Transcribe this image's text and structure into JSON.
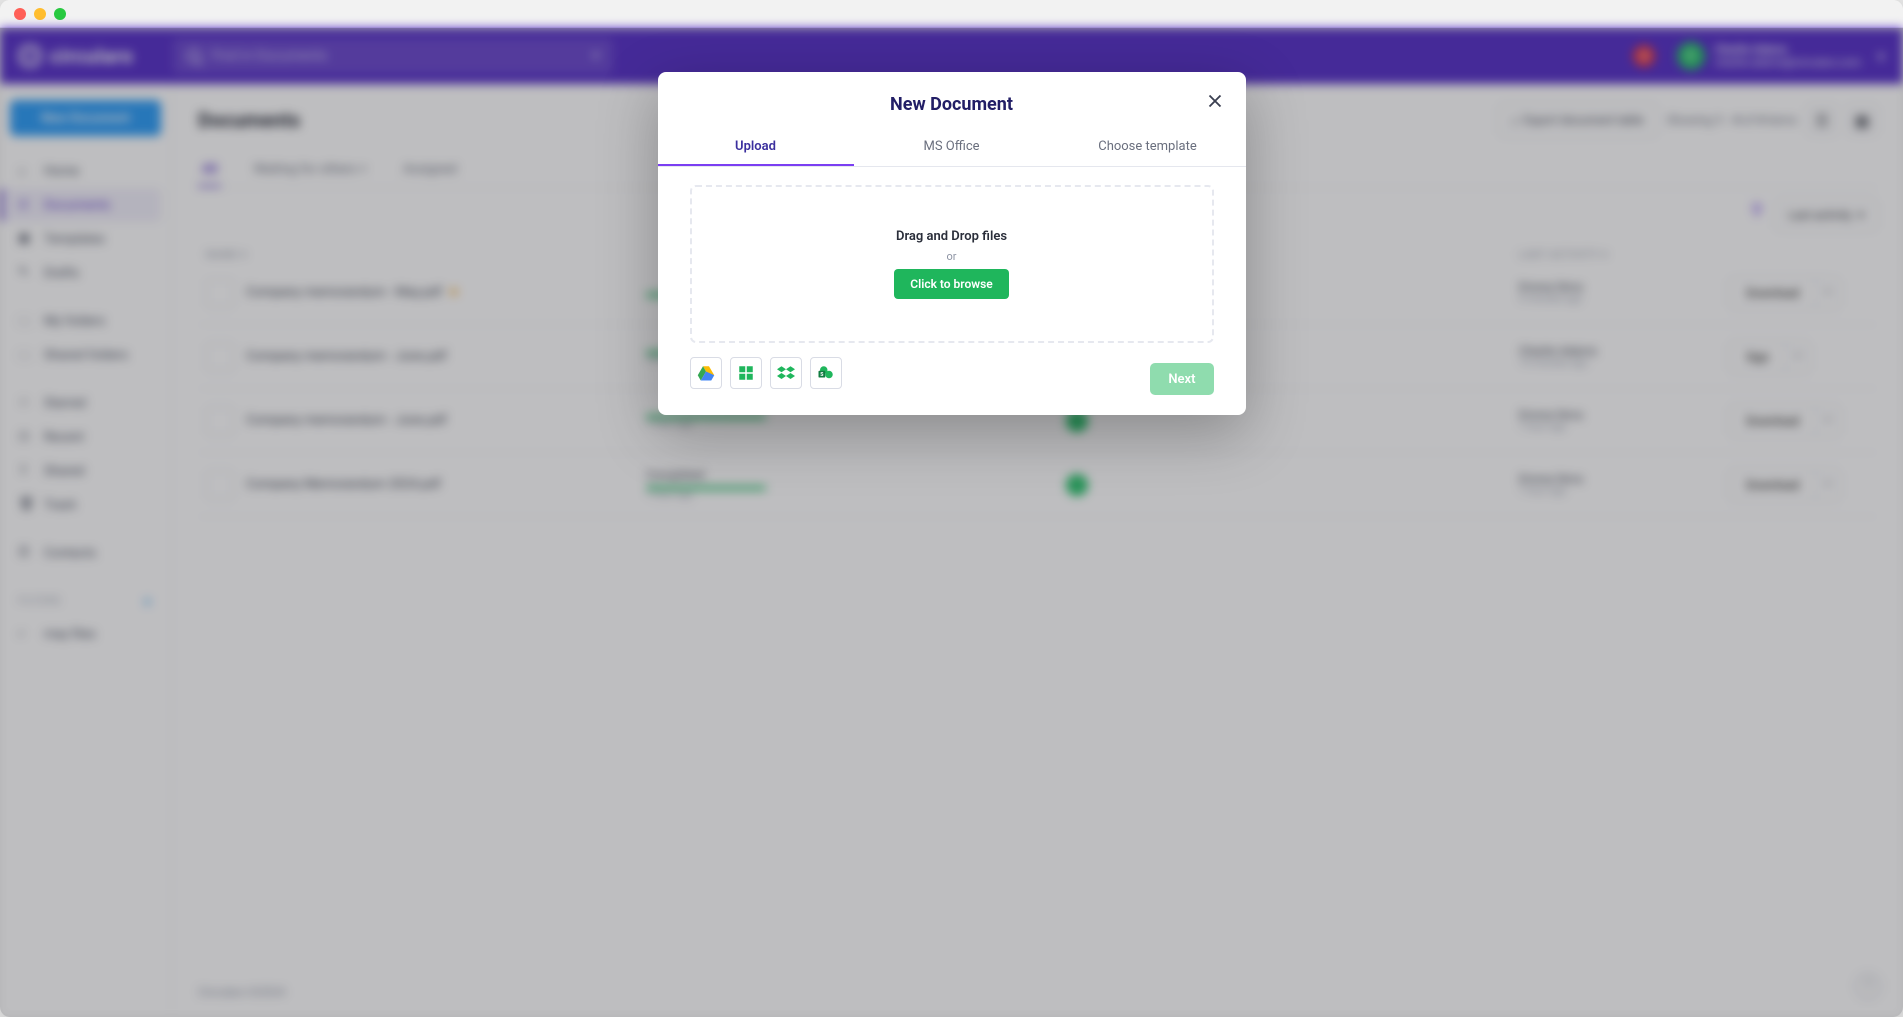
{
  "brand": "circularo",
  "search_placeholder": "Find in Documents",
  "notifications_count": "4",
  "user": {
    "initial": "C",
    "name": "Charlie Adams",
    "email": "charlie.adams@circularo.com"
  },
  "sidebar": {
    "new_doc": "New Document",
    "items": [
      "Home",
      "Documents",
      "Templates",
      "Drafts"
    ],
    "items2": [
      "My folders",
      "Shared folders"
    ],
    "items3": [
      "Starred",
      "Recent",
      "Shared",
      "Trash"
    ],
    "items4": [
      "Contacts"
    ],
    "filters_label": "FILTERS",
    "filter_items": [
      "may files"
    ]
  },
  "page": {
    "title": "Documents",
    "export": "Export document table",
    "showing_pre": "Showing ",
    "showing_range": "1 - 4",
    "showing_mid": " of ",
    "showing_total": "4",
    "showing_post": " items",
    "tabs": [
      "All",
      "Waiting for others",
      "Assigned"
    ],
    "sort": "Last activity",
    "columns": {
      "name": "NAME",
      "status": "",
      "owner": "",
      "last": "LAST ACTIVITY",
      "act": ""
    }
  },
  "rows": [
    {
      "name": "Company memorandum - May.pdf",
      "starred": true,
      "status": "",
      "status_sub": "",
      "owner": "green",
      "who": "Emma Sims",
      "when": "6 minutes ago",
      "action": "Download"
    },
    {
      "name": "Company memorandum - June.pdf",
      "starred": false,
      "status": "",
      "status_sub": "14 minutes ago",
      "owner": "purple",
      "who": "Charlie Adams",
      "when": "14 minutes ago",
      "action": "Sign"
    },
    {
      "name": "Company memorandum - June.pdf",
      "starred": false,
      "status": "",
      "status_sub": "1 hour ago",
      "owner": "green",
      "who": "Emma Sims",
      "when": "1 hour ago",
      "action": "Download"
    },
    {
      "name": "Company Memorandum 2024.pdf",
      "starred": false,
      "status": "Completed",
      "status_sub": "1 hour ago",
      "owner": "green",
      "who": "Emma Sims",
      "when": "1 hour ago",
      "action": "Download"
    }
  ],
  "footer": "Circularo ©2024",
  "modal": {
    "title": "New Document",
    "tabs": [
      "Upload",
      "MS Office",
      "Choose template"
    ],
    "dz_title": "Drag and Drop files",
    "dz_or": "or",
    "browse": "Click to browse",
    "next": "Next",
    "providers": [
      "google-drive",
      "onedrive",
      "dropbox",
      "sharepoint"
    ]
  }
}
